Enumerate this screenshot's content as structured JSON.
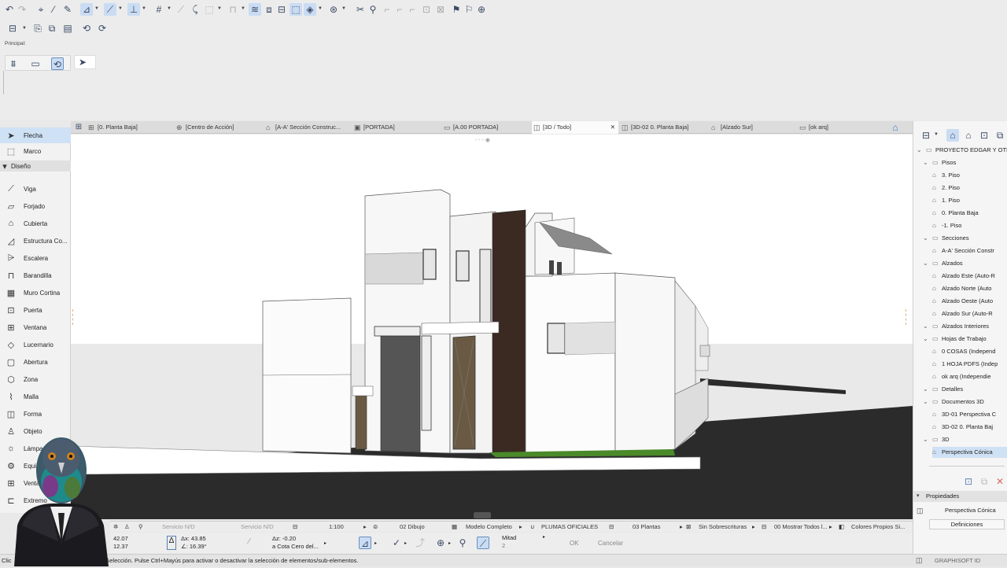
{
  "toolbar": {
    "palette_label": "Principal:"
  },
  "toolbox": {
    "items": [
      {
        "label": "Flecha",
        "icon": "arrow-icon",
        "glyph": "➤"
      },
      {
        "label": "Marco",
        "icon": "marquee-icon",
        "glyph": "⬚"
      },
      {
        "label": "Diseño",
        "icon": "chevron-down-icon",
        "glyph": "▾"
      },
      {
        "label": "Viga",
        "icon": "beam-icon",
        "glyph": "⟋"
      },
      {
        "label": "Forjado",
        "icon": "slab-icon",
        "glyph": "▱"
      },
      {
        "label": "Cubierta",
        "icon": "roof-icon",
        "glyph": "⌂"
      },
      {
        "label": "Estructura Co...",
        "icon": "shell-icon",
        "glyph": "◿"
      },
      {
        "label": "Escalera",
        "icon": "stair-icon",
        "glyph": "⩥"
      },
      {
        "label": "Barandilla",
        "icon": "railing-icon",
        "glyph": "⊓"
      },
      {
        "label": "Muro Cortina",
        "icon": "curtain-wall-icon",
        "glyph": "▦"
      },
      {
        "label": "Puerta",
        "icon": "door-icon",
        "glyph": "⊡"
      },
      {
        "label": "Ventana",
        "icon": "window-icon",
        "glyph": "⊞"
      },
      {
        "label": "Lucernario",
        "icon": "skylight-icon",
        "glyph": "◇"
      },
      {
        "label": "Abertura",
        "icon": "opening-icon",
        "glyph": "▢"
      },
      {
        "label": "Zona",
        "icon": "zone-icon",
        "glyph": "⬡"
      },
      {
        "label": "Malla",
        "icon": "mesh-icon",
        "glyph": "⌇"
      },
      {
        "label": "Forma",
        "icon": "morph-icon",
        "glyph": "◫"
      },
      {
        "label": "Objeto",
        "icon": "object-icon",
        "glyph": "♙"
      },
      {
        "label": "Lámpara",
        "icon": "lamp-icon",
        "glyph": "☼"
      },
      {
        "label": "Equipo",
        "icon": "equipment-icon",
        "glyph": "⚙"
      },
      {
        "label": "Ventana",
        "icon": "window-icon",
        "glyph": "⊞"
      },
      {
        "label": "Extremo",
        "icon": "wall-end-icon",
        "glyph": "⊏"
      }
    ]
  },
  "tabs": [
    {
      "label": "[0. Planta Baja]",
      "icon": "floor-plan-icon"
    },
    {
      "label": "[Centro de Acción]",
      "icon": "action-center-icon"
    },
    {
      "label": "[A-A' Sección Construc...",
      "icon": "section-icon"
    },
    {
      "label": "[PORTADA]",
      "icon": "layout-icon"
    },
    {
      "label": "[A.00 PORTADA]",
      "icon": "layout-icon"
    },
    {
      "label": "[3D / Todo]",
      "icon": "3d-icon"
    },
    {
      "label": "[3D-02 0. Planta Baja]",
      "icon": "3d-document-icon"
    },
    {
      "label": "[Alzado Sur]",
      "icon": "elevation-icon"
    },
    {
      "label": "[ok arq]",
      "icon": "worksheet-icon"
    }
  ],
  "navigator": {
    "items": [
      {
        "label": "PROYECTO EDGAR Y OTI",
        "level": 0
      },
      {
        "label": "Pisos",
        "level": 1
      },
      {
        "label": "3. Piso",
        "level": 2
      },
      {
        "label": "2. Piso",
        "level": 2
      },
      {
        "label": "1. Piso",
        "level": 2
      },
      {
        "label": "0. Planta Baja",
        "level": 2
      },
      {
        "label": "-1. Piso",
        "level": 2
      },
      {
        "label": "Secciones",
        "level": 1
      },
      {
        "label": "A-A' Sección Constr",
        "level": 2
      },
      {
        "label": "Alzados",
        "level": 1
      },
      {
        "label": "Alzado Este (Auto-R",
        "level": 2
      },
      {
        "label": "Alzado Norte (Auto",
        "level": 2
      },
      {
        "label": "Alzado Oeste (Auto",
        "level": 2
      },
      {
        "label": "Alzado Sur (Auto-R",
        "level": 2
      },
      {
        "label": "Alzados Interiores",
        "level": 1
      },
      {
        "label": "Hojas de Trabajo",
        "level": 1
      },
      {
        "label": "0 COSAS (Independ",
        "level": 2
      },
      {
        "label": "1 HOJA PDFS (Indep",
        "level": 2
      },
      {
        "label": "ok arq (Independie",
        "level": 2
      },
      {
        "label": "Detalles",
        "level": 1
      },
      {
        "label": "Documentos 3D",
        "level": 1
      },
      {
        "label": "3D-01 Perspectiva C",
        "level": 2
      },
      {
        "label": "3D-02 0. Planta Baj",
        "level": 2
      },
      {
        "label": "3D",
        "level": 1
      },
      {
        "label": "Perspectiva Cónica",
        "level": 2
      }
    ],
    "properties_label": "Propiedades",
    "properties_value": "Perspectiva Cónica",
    "definitions_label": "Definiciones"
  },
  "infobar": {
    "service1": "Servicio N/D",
    "service2": "Servicio N/D",
    "scale": "1:100",
    "layer_combo": "02 Dibujo",
    "model": "Modelo Completo",
    "pens": "PLUMAS OFICIALES",
    "floors": "03 Plantas",
    "overrides": "Sin Sobrescrituras",
    "renovation": "00 Mostrar Todos l...",
    "colors": "Colores Propios Si..."
  },
  "coords": {
    "x": "42.07",
    "y": "12.37",
    "dx": "Δx: 43.85",
    "angle": "∠: 16.39°",
    "dz": "Δz: -0.20",
    "ref": "a Cota Cero del...",
    "snap_label": "Mitad",
    "snap_value": "2",
    "ok": "OK",
    "cancel": "Cancelar"
  },
  "status": {
    "prefix": "Clic",
    "message": "e Selección. Pulse Ctrl+Mayús para activar o desactivar la selección de elementos/sub-elementos.",
    "brand": "GRAPHISOFT ID"
  },
  "colors": {
    "accent": "#cfe1f5",
    "ground": "#2b2b2b",
    "wood": "#3a2a22"
  }
}
